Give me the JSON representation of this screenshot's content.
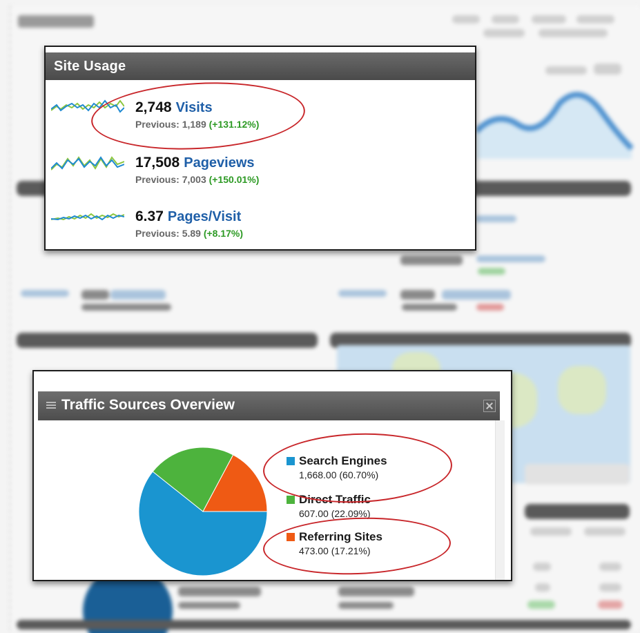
{
  "site_usage": {
    "title": "Site Usage",
    "metrics": [
      {
        "value": "2,748",
        "label": "Visits",
        "prev_label": "Previous: 1,189",
        "change": "(+131.12%)"
      },
      {
        "value": "17,508",
        "label": "Pageviews",
        "prev_label": "Previous: 7,003",
        "change": "(+150.01%)"
      },
      {
        "value": "6.37",
        "label": "Pages/Visit",
        "prev_label": "Previous: 5.89",
        "change": "(+8.17%)"
      }
    ]
  },
  "traffic_sources": {
    "title": "Traffic Sources Overview",
    "slices": [
      {
        "name": "Search Engines",
        "value": "1,668.00 (60.70%)",
        "percent": 60.7,
        "color": "#1a95d0"
      },
      {
        "name": "Direct Traffic",
        "value": "607.00 (22.09%)",
        "percent": 22.09,
        "color": "#4db33d"
      },
      {
        "name": "Referring Sites",
        "value": "473.00 (17.21%)",
        "percent": 17.21,
        "color": "#ef5a14"
      }
    ]
  },
  "colors": {
    "link_blue": "#1f5fa8",
    "positive_green": "#2d9a24",
    "highlight_red": "#c8262a",
    "header_gray": "#555555"
  },
  "icons": {
    "menu": "grip-lines-icon",
    "close": "close-icon"
  }
}
